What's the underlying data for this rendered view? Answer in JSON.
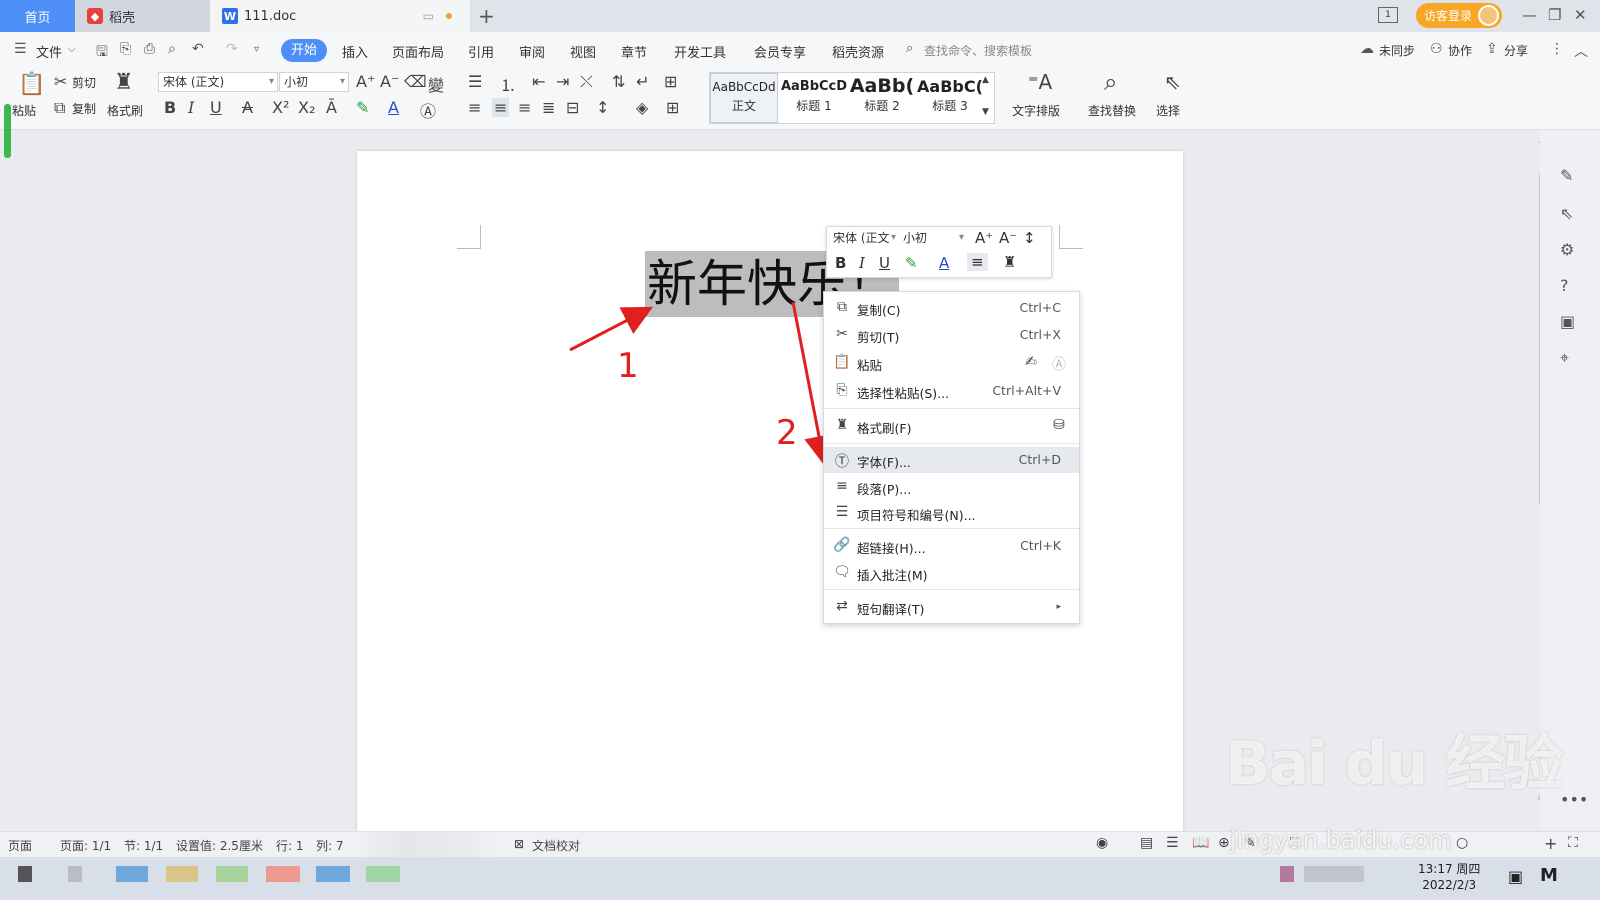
{
  "tabs": {
    "home": "首页",
    "daoke": "稻壳",
    "doc": "111.doc"
  },
  "header": {
    "login": "访客登录"
  },
  "menubar": {
    "file": "文件",
    "items": [
      "开始",
      "插入",
      "页面布局",
      "引用",
      "审阅",
      "视图",
      "章节",
      "开发工具",
      "会员专享",
      "稻壳资源"
    ],
    "search_placeholder": "查找命令、搜索模板",
    "sync": "未同步",
    "collab": "协作",
    "share": "分享"
  },
  "ribbon": {
    "paste": "粘贴",
    "cut": "剪切",
    "copy": "复制",
    "format_painter": "格式刷",
    "font_name": "宋体 (正文)",
    "font_size": "小初",
    "styles": [
      {
        "preview": "AaBbCcDd",
        "name": "正文"
      },
      {
        "preview": "AaBbCcD",
        "name": "标题 1"
      },
      {
        "preview": "AaBb(",
        "name": "标题 2"
      },
      {
        "preview": "AaBbC(",
        "name": "标题 3"
      }
    ],
    "text_layout": "文字排版",
    "find_replace": "查找替换",
    "select": "选择"
  },
  "document": {
    "text": "新年快乐！"
  },
  "mini_toolbar": {
    "font_name": "宋体 (正文",
    "font_size": "小初"
  },
  "context_menu": {
    "items": [
      {
        "label": "复制(C)",
        "shortcut": "Ctrl+C",
        "icon": "copy-icon"
      },
      {
        "label": "剪切(T)",
        "shortcut": "Ctrl+X",
        "icon": "scissors-icon"
      },
      {
        "label": "粘贴",
        "shortcut": "",
        "icon": "paste-icon"
      },
      {
        "label": "选择性粘贴(S)...",
        "shortcut": "Ctrl+Alt+V",
        "icon": "paste-special-icon"
      },
      {
        "label": "格式刷(F)",
        "shortcut": "",
        "icon": "format-painter-icon"
      },
      {
        "label": "字体(F)...",
        "shortcut": "Ctrl+D",
        "icon": "font-icon"
      },
      {
        "label": "段落(P)...",
        "shortcut": "",
        "icon": "paragraph-icon"
      },
      {
        "label": "项目符号和编号(N)...",
        "shortcut": "",
        "icon": "bullets-icon"
      },
      {
        "label": "超链接(H)...",
        "shortcut": "Ctrl+K",
        "icon": "link-icon"
      },
      {
        "label": "插入批注(M)",
        "shortcut": "",
        "icon": "comment-icon"
      },
      {
        "label": "短句翻译(T)",
        "shortcut": "",
        "icon": "translate-icon"
      }
    ],
    "highlighted_index": 5
  },
  "annotations": {
    "step1": "1",
    "step2": "2"
  },
  "statusbar": {
    "page_label": "页面",
    "page": "页面: 1/1",
    "section": "节: 1/1",
    "setting": "设置值: 2.5厘米",
    "row": "行: 1",
    "col": "列: 7",
    "proofread": "文档校对"
  },
  "taskbar": {
    "time": "13:17 周四",
    "date": "2022/2/3"
  },
  "watermark": {
    "main": "Bai du 经验",
    "sub": "jingyan.baidu.com"
  },
  "colors": {
    "accent": "#4e8ef7",
    "selection": "#bdbdbd",
    "annotation": "#e02020",
    "login": "#f7a626"
  }
}
